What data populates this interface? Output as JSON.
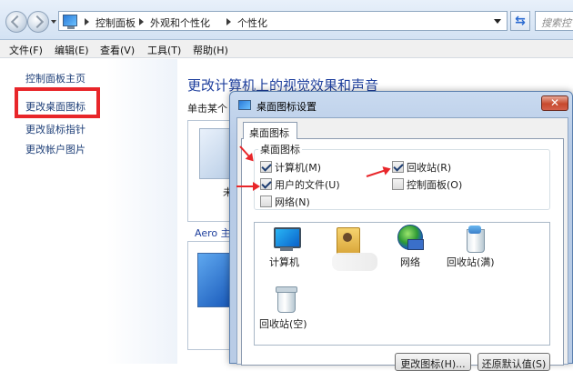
{
  "address": {
    "crumbs": [
      "控制面板",
      "外观和个性化",
      "个性化"
    ],
    "search_placeholder": "搜索控"
  },
  "menu": [
    "文件(F)",
    "编辑(E)",
    "查看(V)",
    "工具(T)",
    "帮助(H)"
  ],
  "sidebar": {
    "items": [
      {
        "label": "控制面板主页"
      },
      {
        "label": "更改桌面图标"
      },
      {
        "label": "更改鼠标指针"
      },
      {
        "label": "更改帐户图片"
      }
    ]
  },
  "main": {
    "title": "更改计算机上的视觉效果和声音",
    "desc": "单击某个",
    "theme_label": "未",
    "aero_label": "Aero 主"
  },
  "dialog": {
    "title": "桌面图标设置",
    "tab": "桌面图标",
    "group_label": "桌面图标",
    "checkboxes": [
      {
        "label": "计算机(M)",
        "checked": true
      },
      {
        "label": "回收站(R)",
        "checked": true
      },
      {
        "label": "用户的文件(U)",
        "checked": true
      },
      {
        "label": "控制面板(O)",
        "checked": false
      },
      {
        "label": "网络(N)",
        "checked": false
      }
    ],
    "icons": [
      {
        "label": "计算机"
      },
      {
        "label": "网络"
      },
      {
        "label": "回收站(满)"
      },
      {
        "label": "回收站(空)"
      }
    ],
    "buttons": {
      "change_icon": "更改图标(H)...",
      "restore_default": "还原默认值(S)"
    }
  },
  "colors": {
    "annotation_red": "#e8262a",
    "link_blue": "#1e3f78",
    "title_blue": "#1e3f9d"
  }
}
